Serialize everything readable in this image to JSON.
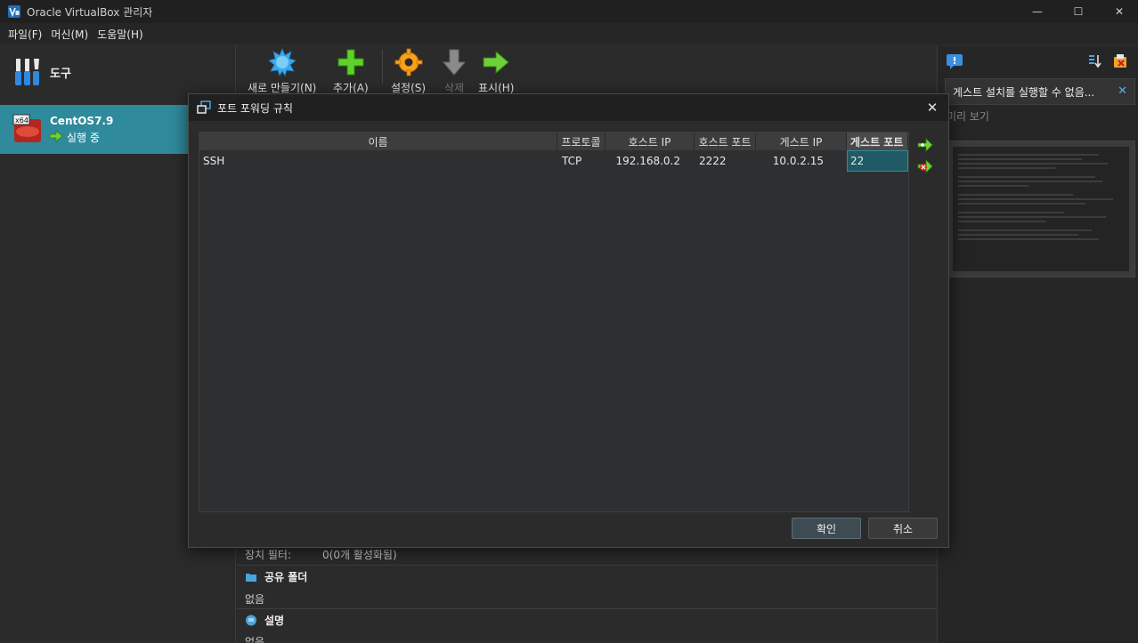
{
  "window": {
    "title": "Oracle VirtualBox 관리자",
    "minimize_glyph": "—",
    "maximize_glyph": "☐",
    "close_glyph": "✕"
  },
  "menu": [
    "파일(F)",
    "머신(M)",
    "도움말(H)"
  ],
  "left_pane": {
    "tools_label": "도구",
    "vm": {
      "name": "CentOS7.9",
      "state": "실행 중",
      "os_badge": "x64"
    }
  },
  "toolbar": {
    "new_label": "새로 만들기(N)",
    "add_label": "추가(A)",
    "settings_label": "설정(S)",
    "remove_label": "삭제",
    "show_label": "표시(H)"
  },
  "details": {
    "usb_filter_label": "장치 필터:",
    "usb_filter_value": "0(0개 활성화됨)",
    "shared_folders_header": "공유 폴더",
    "shared_folders_value": "없음",
    "description_header": "설명",
    "description_value": "없음"
  },
  "right_pane": {
    "notice_text": "게스트 설치를 실행할 수 없음...",
    "notice_close": "✕",
    "preview_label": "미리 보기"
  },
  "dialog": {
    "title": "포트 포워딩 규칙",
    "close_glyph": "✕",
    "columns": [
      "이름",
      "프로토콜",
      "호스트 IP",
      "호스트 포트",
      "게스트 IP",
      "게스트 포트"
    ],
    "rows": [
      {
        "name": "SSH",
        "protocol": "TCP",
        "host_ip": "192.168.0.2",
        "host_port": "2222",
        "guest_ip": "10.0.2.15",
        "guest_port": "22"
      }
    ],
    "ok_label": "확인",
    "cancel_label": "취소"
  },
  "colors": {
    "selection": "#2f8a9c",
    "background": "#2b2b2b",
    "titlebar": "#202020"
  }
}
